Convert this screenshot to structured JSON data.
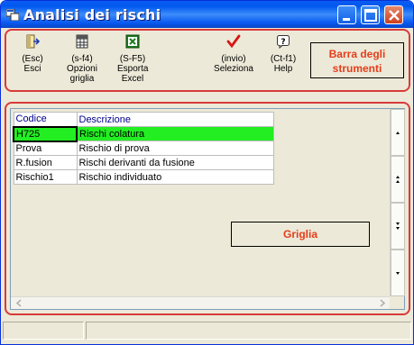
{
  "window": {
    "title": "Analisi dei rischi"
  },
  "toolbar": {
    "buttons": [
      {
        "key": "(Esc)",
        "label": "Esci",
        "icon": "exit-door-icon"
      },
      {
        "key": "(s-f4)",
        "label": "Opzioni griglia",
        "icon": "grid-options-icon"
      },
      {
        "key": "(S-F5)",
        "label": "Esporta Excel",
        "icon": "excel-icon"
      },
      {
        "key": "(invio)",
        "label": "Seleziona",
        "icon": "checkmark-icon"
      },
      {
        "key": "(Ct-f1)",
        "label": "Help",
        "icon": "help-icon"
      }
    ],
    "annotation": "Barra degli strumenti"
  },
  "grid": {
    "columns": [
      "Codice",
      "Descrizione"
    ],
    "rows": [
      {
        "code": "H725",
        "desc": "Rischi colatura",
        "selected": true
      },
      {
        "code": "Prova",
        "desc": "Rischio di prova",
        "selected": false
      },
      {
        "code": "R.fusion",
        "desc": "Rischi derivanti da fusione",
        "selected": false
      },
      {
        "code": "Rischio1",
        "desc": "Rischio individuato",
        "selected": false
      }
    ],
    "annotation": "Griglia"
  },
  "colors": {
    "selected_row": "#22ee22",
    "annotation_text": "#e53d1a",
    "panel_border": "#d93a3a"
  }
}
